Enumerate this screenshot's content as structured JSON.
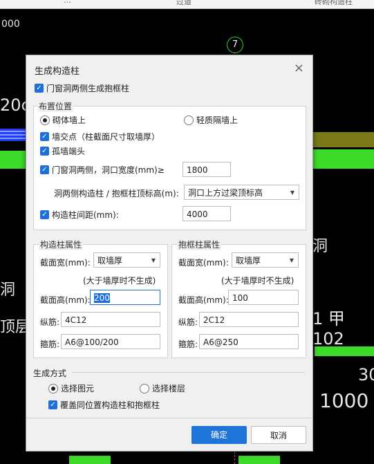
{
  "background": {
    "topbar_left": "…",
    "topbar_mid": "过道",
    "topbar_right": "砖砌构造柱",
    "axis_label": "7",
    "left_texts": [
      "20c",
      "洞",
      "顶层"
    ],
    "right_texts": [
      "洞",
      "1  甲102",
      "30",
      "1000"
    ],
    "topleft_text": "000"
  },
  "dialog": {
    "title": "生成构造柱",
    "close_icon": "×",
    "top_checkbox": "门窗洞两侧生成抱框柱",
    "layout_group": {
      "title": "布置位置",
      "radio_masonry": "砌体墙上",
      "radio_light": "轻质隔墙上",
      "cb_intersection": "墙交点（柱截面尺寸取墙厚）",
      "cb_isolated": "孤墙端头",
      "cb_opening": "门窗洞两侧，洞口宽度(mm)≥",
      "opening_width": "1800",
      "elev_label": "洞两侧构造柱 / 抱框柱顶标高(m):",
      "elev_value": "洞口上方过梁顶标高",
      "cb_spacing": "构造柱间距(mm):",
      "spacing_value": "4000"
    },
    "gzz_group": {
      "title": "构造柱属性",
      "width_label": "截面宽(mm):",
      "width_value": "取墙厚",
      "note": "(大于墙厚时不生成)",
      "height_label": "截面高(mm):",
      "height_value": "200",
      "long_label": "纵筋:",
      "long_value": "4C12",
      "stirrup_label": "箍筋:",
      "stirrup_value": "A6@100/200"
    },
    "bkz_group": {
      "title": "抱框柱属性",
      "width_label": "截面宽(mm):",
      "width_value": "取墙厚",
      "note": "(大于墙厚时不生成)",
      "height_label": "截面高(mm):",
      "height_value": "100",
      "long_label": "纵筋:",
      "long_value": "2C12",
      "stirrup_label": "箍筋:",
      "stirrup_value": "A6@250"
    },
    "gen_group": {
      "title": "生成方式",
      "radio_select": "选择图元",
      "radio_floor": "选择楼层",
      "cb_overwrite": "覆盖同位置构造柱和抱框柱"
    },
    "ok_button": "确定",
    "cancel_button": "取消"
  }
}
